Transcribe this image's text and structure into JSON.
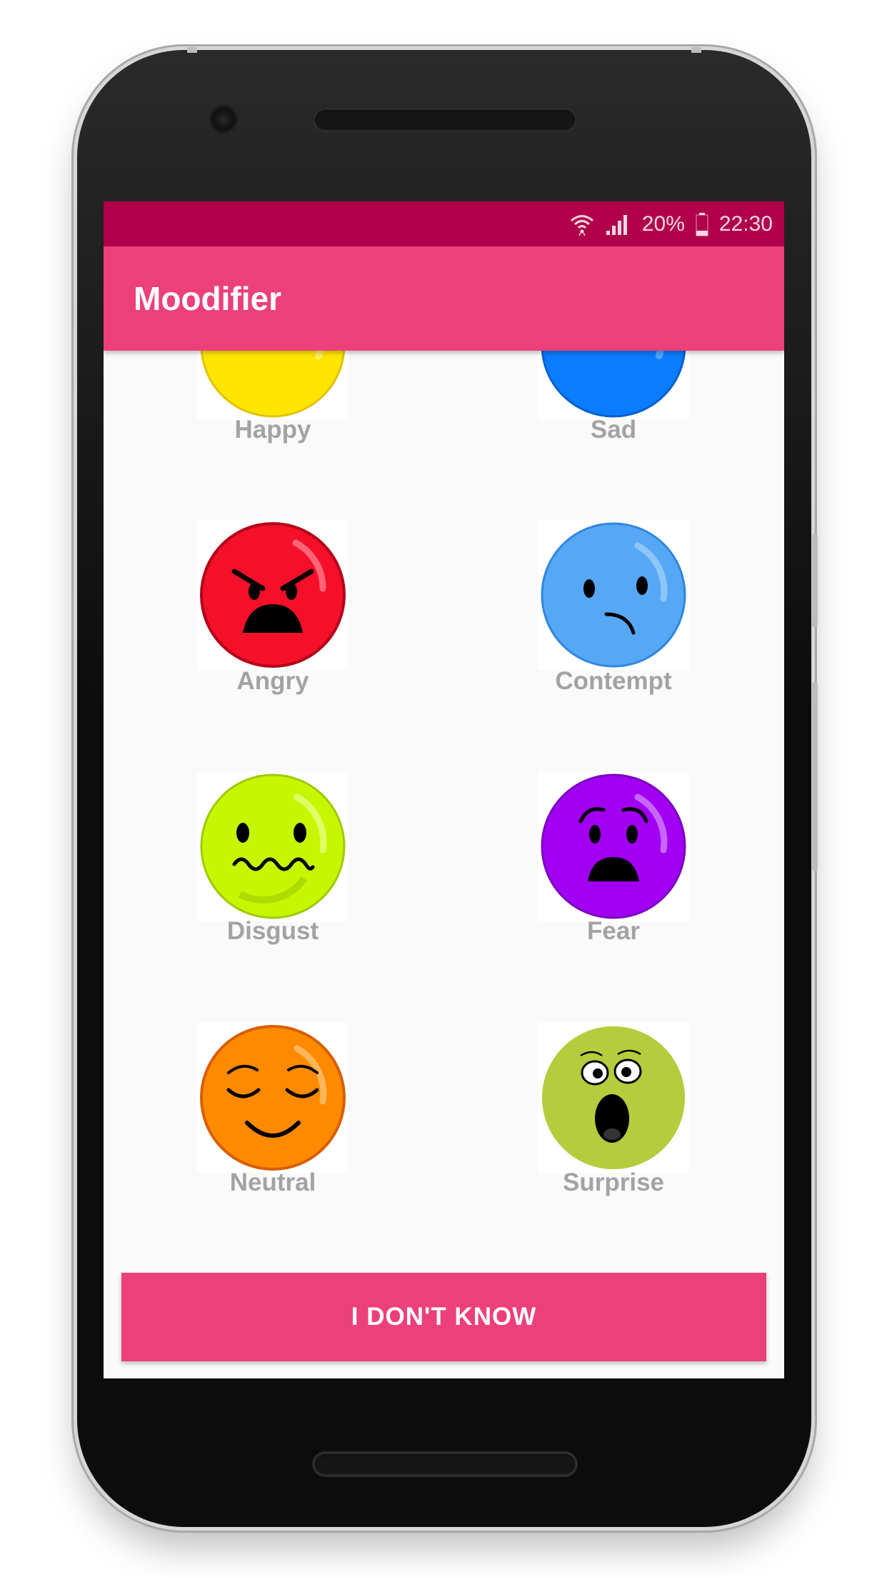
{
  "status_bar": {
    "battery": "20%",
    "time": "22:30",
    "icons": [
      "wifi-icon",
      "signal-icon",
      "battery-icon"
    ]
  },
  "app_bar": {
    "title": "Moodifier"
  },
  "moods": [
    {
      "label": "Happy",
      "icon": "happy-face-icon",
      "color": "#ffe600"
    },
    {
      "label": "Sad",
      "icon": "sad-face-icon",
      "color": "#0a7cff"
    },
    {
      "label": "Angry",
      "icon": "angry-face-icon",
      "color": "#f5102a"
    },
    {
      "label": "Contempt",
      "icon": "contempt-face-icon",
      "color": "#56a8f5"
    },
    {
      "label": "Disgust",
      "icon": "disgust-face-icon",
      "color": "#c6f700"
    },
    {
      "label": "Fear",
      "icon": "fear-face-icon",
      "color": "#a100f2"
    },
    {
      "label": "Neutral",
      "icon": "neutral-face-icon",
      "color": "#ff8a00"
    },
    {
      "label": "Surprise",
      "icon": "surprise-face-icon",
      "color": "#b5cc3c"
    }
  ],
  "button": {
    "label": "I DON'T KNOW",
    "color": "#ec407a"
  },
  "theme": {
    "primary": "#ec407a",
    "status_bar": "#b0004a",
    "label": "#a3a3a3"
  }
}
